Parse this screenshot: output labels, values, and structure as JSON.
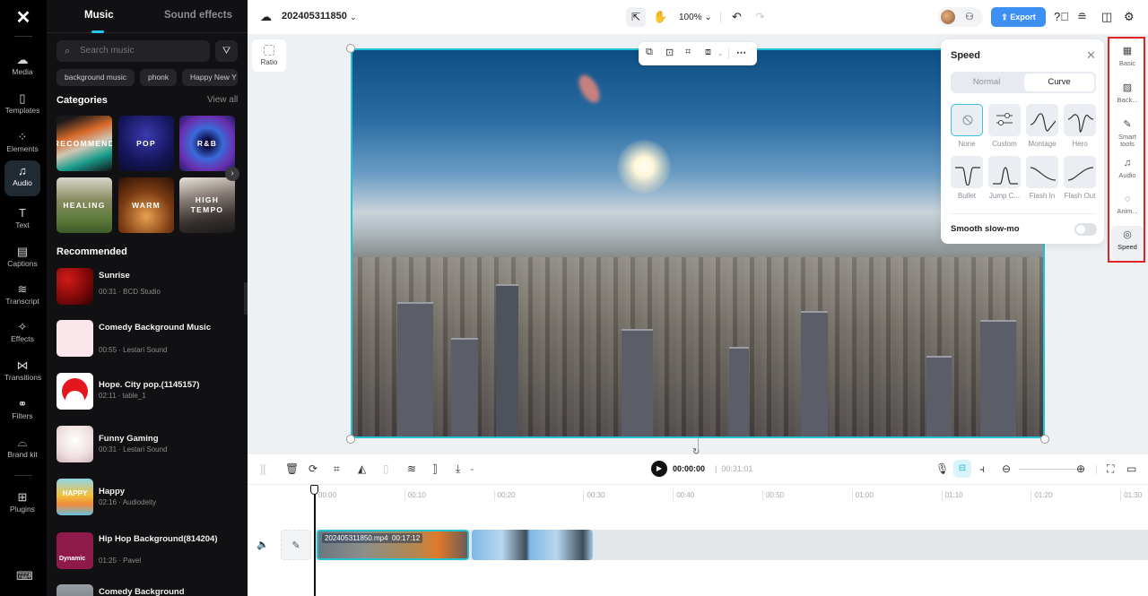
{
  "rail": {
    "logo": "capcut-logo",
    "items": [
      {
        "label": "Media",
        "icon": "cloud-upload-icon",
        "glyph": "☁"
      },
      {
        "label": "Templates",
        "icon": "templates-icon",
        "glyph": "▯"
      },
      {
        "label": "Elements",
        "icon": "elements-icon",
        "glyph": "⁘"
      },
      {
        "label": "Audio",
        "icon": "music-note-icon",
        "glyph": "♫",
        "active": true
      },
      {
        "label": "Text",
        "icon": "text-icon",
        "glyph": "T"
      },
      {
        "label": "Captions",
        "icon": "captions-icon",
        "glyph": "▤"
      },
      {
        "label": "Transcript",
        "icon": "transcript-icon",
        "glyph": "≋"
      },
      {
        "label": "Effects",
        "icon": "effects-icon",
        "glyph": "✧"
      },
      {
        "label": "Transitions",
        "icon": "transitions-icon",
        "glyph": "⋈"
      },
      {
        "label": "Filters",
        "icon": "filters-icon",
        "glyph": "⚭"
      },
      {
        "label": "Brand kit",
        "icon": "brand-kit-icon",
        "glyph": "⌓"
      },
      {
        "label": "Plugins",
        "icon": "plugins-icon",
        "glyph": "⊞"
      }
    ],
    "keyboard_icon": "⌨"
  },
  "panel": {
    "tabs": {
      "music": "Music",
      "sfx": "Sound effects"
    },
    "search": {
      "placeholder": "Search music",
      "icon": "⌕",
      "filter_icon": "⛛"
    },
    "chips": [
      "background music",
      "phonk",
      "Happy New Y"
    ],
    "categories_title": "Categories",
    "view_all": "View all",
    "categories": [
      "RECOMMEND",
      "POP",
      "R&B",
      "HEALING",
      "WARM",
      "HIGH TEMPO"
    ],
    "recommended_title": "Recommended",
    "tracks": [
      {
        "title": "Sunrise",
        "meta": "00:31 · BCD Studio"
      },
      {
        "title": "Comedy Background Music",
        "meta": "00:55 · Lestari Sound"
      },
      {
        "title": "Hope. City pop.(1145157)",
        "meta": "02:11 · table_1"
      },
      {
        "title": "Funny Gaming",
        "meta": "00:31 · Lestari Sound"
      },
      {
        "title": "Happy",
        "meta": "02:16 · Audiodeity"
      },
      {
        "title": "Hip Hop Background(814204)",
        "meta": "01:25 · Pavel"
      },
      {
        "title": "Comedy Background",
        "meta": ""
      }
    ],
    "thumb_labels": {
      "happy": "HAPPY",
      "dynamic": "Dynamic"
    }
  },
  "header": {
    "project_name": "202405311850",
    "zoom": "100%",
    "export_label": "Export"
  },
  "canvas": {
    "ratio_label": "Ratio"
  },
  "speed_panel": {
    "title": "Speed",
    "modes": {
      "normal": "Normal",
      "curve": "Curve"
    },
    "active_mode": "Curve",
    "presets": [
      "None",
      "Custom",
      "Montage",
      "Hero",
      "Bullet",
      "Jump C...",
      "Flash In",
      "Flash Out"
    ],
    "selected_preset": "None",
    "smooth_label": "Smooth slow-mo",
    "smooth_enabled": false
  },
  "dock": {
    "items": [
      {
        "label": "Basic",
        "icon": "film-icon",
        "glyph": "▦"
      },
      {
        "label": "Back...",
        "icon": "background-icon",
        "glyph": "▨"
      },
      {
        "label": "Smart tools",
        "icon": "magic-wand-icon",
        "glyph": "✎"
      },
      {
        "label": "Audio",
        "icon": "music-note-icon",
        "glyph": "♫"
      },
      {
        "label": "Anim...",
        "icon": "animation-icon",
        "glyph": "◌"
      },
      {
        "label": "Speed",
        "icon": "speedometer-icon",
        "glyph": "◎",
        "active": true
      }
    ]
  },
  "timeline": {
    "current_time": "00:00:00",
    "total_time": "00:31:01",
    "ticks": [
      "00:00",
      "00:10",
      "00:20",
      "00:30",
      "00:40",
      "00:50",
      "01:00",
      "01:10",
      "01:20",
      "01:30"
    ],
    "clip": {
      "name": "202405311850.mp4",
      "duration": "00:17:12"
    }
  }
}
